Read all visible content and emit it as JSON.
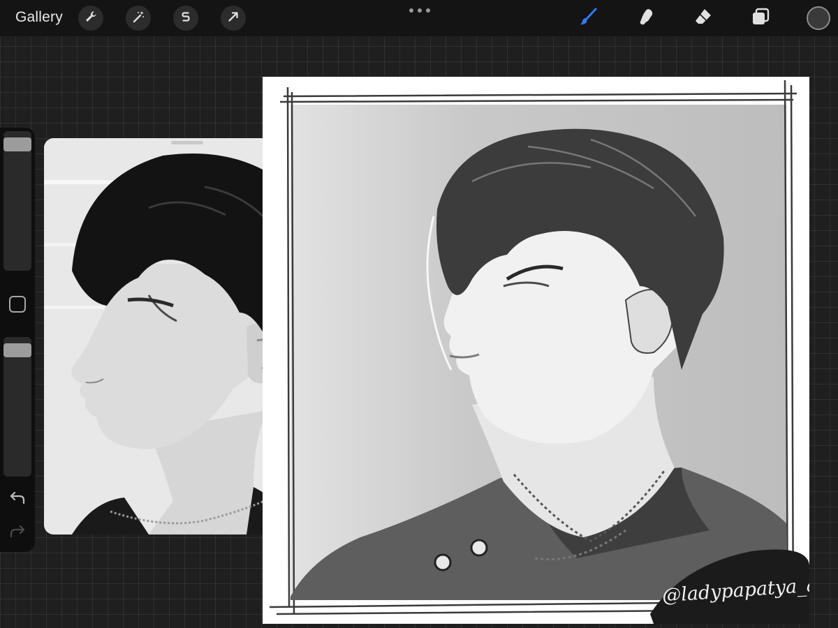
{
  "app": {
    "gallery_label": "Gallery"
  },
  "toolbar": {
    "left_tools": [
      "wrench-icon",
      "magic-wand-icon",
      "selection-icon",
      "transform-arrow-icon"
    ],
    "right_tools": [
      "brush-icon",
      "smudge-icon",
      "eraser-icon",
      "layers-icon"
    ],
    "active_tool": "brush",
    "accent_color": "#2f7bf5",
    "current_color": "#3a3a3a"
  },
  "sidebar": {
    "brush_size_level": 0.95,
    "opacity_level": 0.95
  },
  "canvas": {
    "signature": "@ladypapatya_art"
  }
}
